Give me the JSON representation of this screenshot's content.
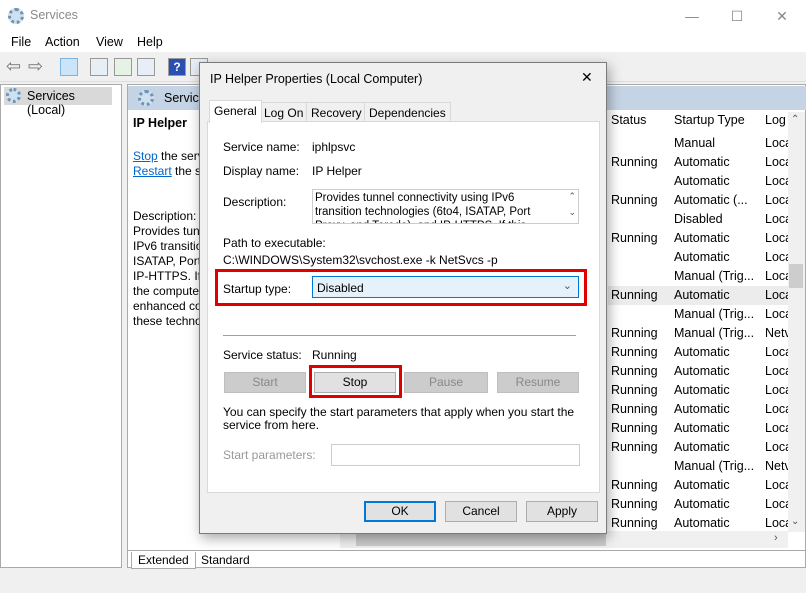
{
  "window": {
    "title": "Services",
    "minimize": "—",
    "maximize": "☐",
    "close": "✕"
  },
  "menu": [
    "File",
    "Action",
    "View",
    "Help"
  ],
  "tree": {
    "root": "Services (Local)"
  },
  "details": {
    "header": "Services",
    "service_title": "IP Helper",
    "stop_link": "Stop",
    "stop_rest": " the serv",
    "restart_link": "Restart",
    "restart_rest": " the se",
    "desc_label": "Description:",
    "desc_lines": [
      "Provides tunn",
      "IPv6 transitio",
      "ISATAP, Port",
      "IP-HTTPS. If t",
      "the compute",
      "enhanced co",
      "these techno"
    ]
  },
  "columns": [
    "Status",
    "Startup Type",
    "Log"
  ],
  "rows": [
    {
      "status": "",
      "startup": "Manual",
      "logon": "Loca"
    },
    {
      "status": "Running",
      "startup": "Automatic",
      "logon": "Loca"
    },
    {
      "status": "",
      "startup": "Automatic",
      "logon": "Loca"
    },
    {
      "status": "Running",
      "startup": "Automatic (...",
      "logon": "Loca"
    },
    {
      "status": "",
      "startup": "Disabled",
      "logon": "Loca"
    },
    {
      "status": "Running",
      "startup": "Automatic",
      "logon": "Loca"
    },
    {
      "status": "",
      "startup": "Automatic",
      "logon": "Loca"
    },
    {
      "status": "",
      "startup": "Manual (Trig...",
      "logon": "Loca"
    },
    {
      "status": "Running",
      "startup": "Automatic",
      "logon": "Loca",
      "selected": true
    },
    {
      "status": "",
      "startup": "Manual (Trig...",
      "logon": "Loca"
    },
    {
      "status": "Running",
      "startup": "Manual (Trig...",
      "logon": "Netv"
    },
    {
      "status": "Running",
      "startup": "Automatic",
      "logon": "Loca"
    },
    {
      "status": "Running",
      "startup": "Automatic",
      "logon": "Loca"
    },
    {
      "status": "Running",
      "startup": "Automatic",
      "logon": "Loca"
    },
    {
      "status": "Running",
      "startup": "Automatic",
      "logon": "Loca"
    },
    {
      "status": "Running",
      "startup": "Automatic",
      "logon": "Loca"
    },
    {
      "status": "Running",
      "startup": "Automatic",
      "logon": "Loca"
    },
    {
      "status": "",
      "startup": "Manual (Trig...",
      "logon": "Netv"
    },
    {
      "status": "Running",
      "startup": "Automatic",
      "logon": "Loca"
    },
    {
      "status": "Running",
      "startup": "Automatic",
      "logon": "Loca"
    },
    {
      "status": "Running",
      "startup": "Automatic",
      "logon": "Loca"
    }
  ],
  "bottom_tabs": [
    "Extended",
    "Standard"
  ],
  "dialog": {
    "title": "IP Helper Properties (Local Computer)",
    "tabs": [
      "General",
      "Log On",
      "Recovery",
      "Dependencies"
    ],
    "service_name_label": "Service name:",
    "service_name": "iphlpsvc",
    "display_name_label": "Display name:",
    "display_name": "IP Helper",
    "description_label": "Description:",
    "description": "Provides tunnel connectivity using IPv6 transition technologies (6to4, ISATAP, Port Proxy, and Teredo), and IP-HTTPS. If this service is stopped",
    "path_label": "Path to executable:",
    "path": "C:\\WINDOWS\\System32\\svchost.exe -k NetSvcs -p",
    "startup_type_label": "Startup type:",
    "startup_type": "Disabled",
    "status_label": "Service status:",
    "status": "Running",
    "buttons": {
      "start": "Start",
      "stop": "Stop",
      "pause": "Pause",
      "resume": "Resume",
      "ok": "OK",
      "cancel": "Cancel",
      "apply": "Apply"
    },
    "hint": "You can specify the start parameters that apply when you start the service from here.",
    "params_label": "Start parameters:",
    "params_value": ""
  },
  "colors": {
    "highlight_box": "#e00000",
    "link": "#0066cc",
    "header_bg": "#c5d4e4",
    "ok_border": "#0078d7"
  }
}
